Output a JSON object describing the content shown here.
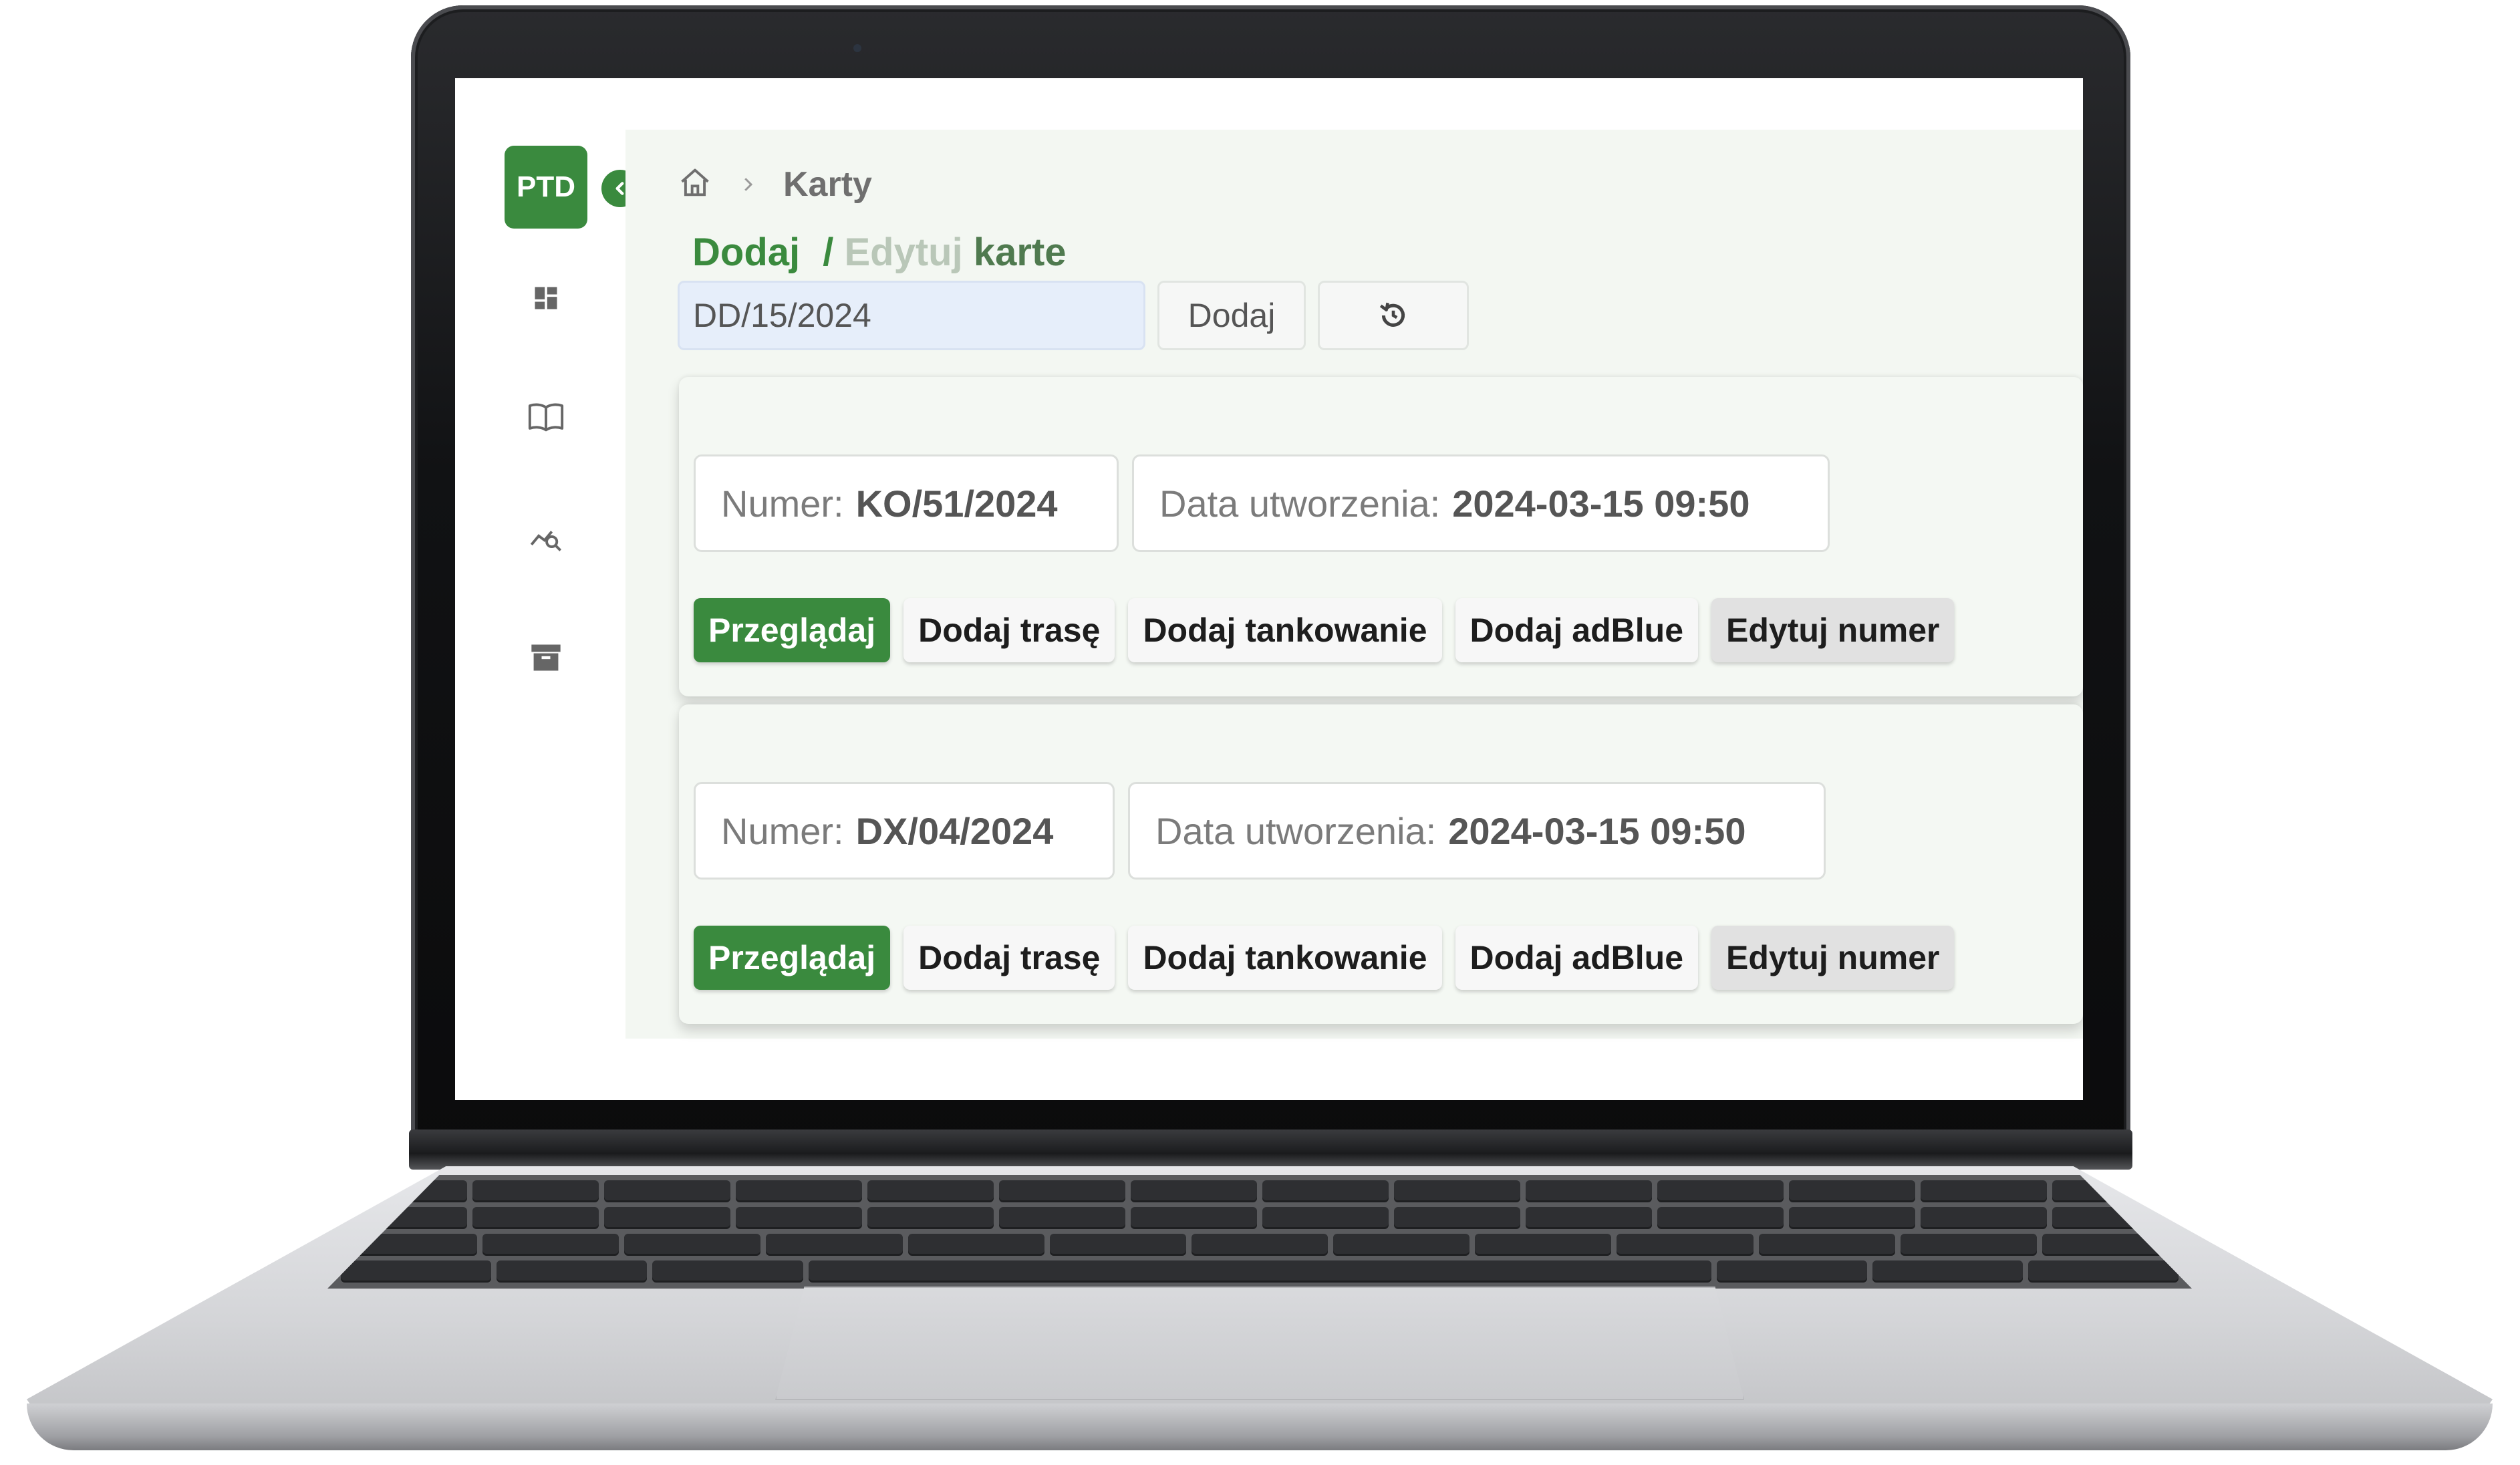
{
  "app": {
    "logo_text": "PTD",
    "accent_color": "#3a8a3e",
    "nav_items": [
      {
        "icon": "dashboard-icon"
      },
      {
        "icon": "book-icon"
      },
      {
        "icon": "analytics-icon"
      },
      {
        "icon": "archive-icon"
      }
    ]
  },
  "breadcrumb": {
    "home_icon": "home-icon",
    "separator_icon": "chevron-right-icon",
    "current": "Karty"
  },
  "page_title": {
    "add": "Dodaj",
    "sep": "/",
    "edit": "Edytuj",
    "noun": "karte"
  },
  "form": {
    "card_number_value": "DD/15/2024",
    "add_label": "Dodaj",
    "reset_icon": "history-icon"
  },
  "cards": [
    {
      "number_label": "Numer:",
      "number": "KO/51/2024",
      "created_label": "Data utworzenia:",
      "created": "2024-03-15 09:50",
      "actions": [
        "Przeglądaj",
        "Dodaj trasę",
        "Dodaj tankowanie",
        "Dodaj adBlue",
        "Edytuj numer"
      ]
    },
    {
      "number_label": "Numer:",
      "number": "DX/04/2024",
      "created_label": "Data utworzenia:",
      "created": "2024-03-15 09:50",
      "actions": [
        "Przeglądaj",
        "Dodaj trasę",
        "Dodaj tankowanie",
        "Dodaj adBlue",
        "Edytuj numer"
      ]
    }
  ]
}
